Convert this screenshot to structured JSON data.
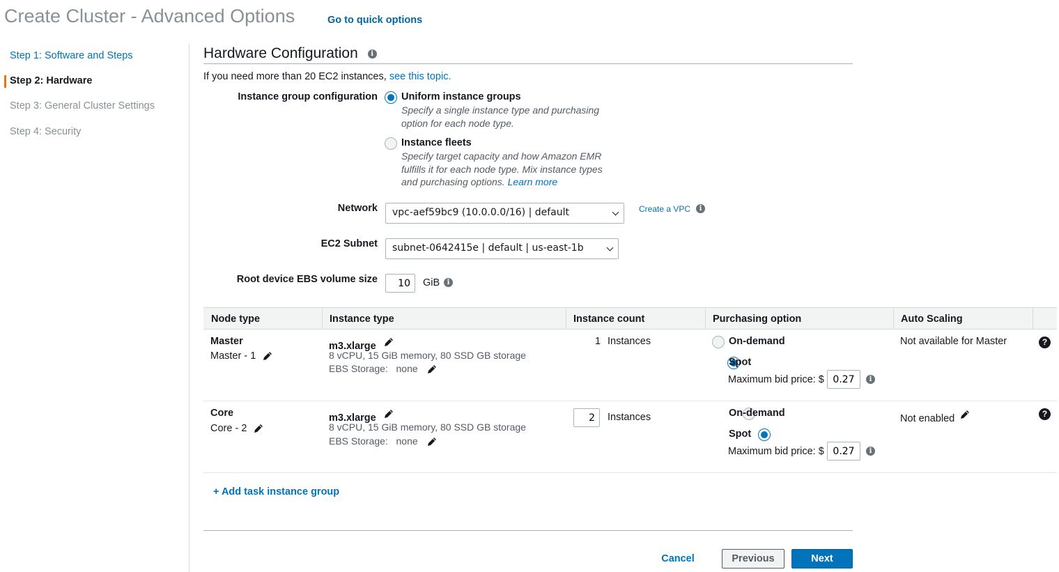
{
  "header": {
    "title": "Create Cluster - Advanced Options",
    "quick_link": "Go to quick options"
  },
  "sidebar": {
    "steps": [
      {
        "label": "Step 1: Software and Steps",
        "state": "link"
      },
      {
        "label": "Step 2: Hardware",
        "state": "active"
      },
      {
        "label": "Step 3: General Cluster Settings",
        "state": "disabled"
      },
      {
        "label": "Step 4: Security",
        "state": "disabled"
      }
    ]
  },
  "section": {
    "title": "Hardware Configuration",
    "intro_text": "If you need more than 20 EC2 instances,",
    "intro_link": "see this topic."
  },
  "instance_group_config": {
    "label": "Instance group configuration",
    "options": [
      {
        "title": "Uniform instance groups",
        "desc_lines": [
          "Specify a single instance type and purchasing",
          "option for each node type."
        ],
        "checked": true
      },
      {
        "title": "Instance fleets",
        "desc_lines": [
          "Specify target capacity and how Amazon EMR",
          "fulfills it for each node type. Mix instance types",
          "and purchasing options."
        ],
        "desc_link": "Learn more",
        "checked": false
      }
    ]
  },
  "network": {
    "label": "Network",
    "value": "vpc-aef59bc9 (10.0.0.0/16) | default",
    "create_link": "Create a VPC"
  },
  "subnet": {
    "label": "EC2 Subnet",
    "value": "subnet-0642415e | default | us-east-1b"
  },
  "ebs_root": {
    "label": "Root device EBS volume size",
    "value": "10",
    "unit": "GiB"
  },
  "table": {
    "headers": [
      "Node type",
      "Instance type",
      "Instance count",
      "Purchasing option",
      "Auto Scaling"
    ],
    "rows": [
      {
        "node_type": "Master",
        "node_sub": "Master - 1",
        "instance_type": "m3.xlarge",
        "instance_desc": "8 vCPU, 15 GiB memory, 80 SSD GB storage",
        "ebs_label": "EBS Storage:",
        "ebs_value": "none",
        "count": "1",
        "count_unit": "Instances",
        "on_demand": "On-demand",
        "spot": "Spot",
        "purchasing": "spot",
        "bid_label": "Maximum bid price: $",
        "bid_value": "0.27",
        "auto_scaling": "Not available for Master"
      },
      {
        "node_type": "Core",
        "node_sub": "Core - 2",
        "instance_type": "m3.xlarge",
        "instance_desc": "8 vCPU, 15 GiB memory, 80 SSD GB storage",
        "ebs_label": "EBS Storage:",
        "ebs_value": "none",
        "count": "2",
        "count_unit": "Instances",
        "on_demand": "On-demand",
        "spot": "Spot",
        "purchasing": "spot",
        "bid_label": "Maximum bid price: $",
        "bid_value": "0.27",
        "auto_scaling": "Not enabled"
      }
    ]
  },
  "add_task_group": "+ Add task instance group",
  "footer": {
    "cancel": "Cancel",
    "previous": "Previous",
    "next": "Next"
  },
  "colors": {
    "link": "#0073bb",
    "primary_button": "#0073bb",
    "active_step_marker": "#ec7211",
    "title_gray": "#879196"
  },
  "icons": [
    "info-icon",
    "help-icon",
    "pencil-icon",
    "chevron-down-icon"
  ]
}
